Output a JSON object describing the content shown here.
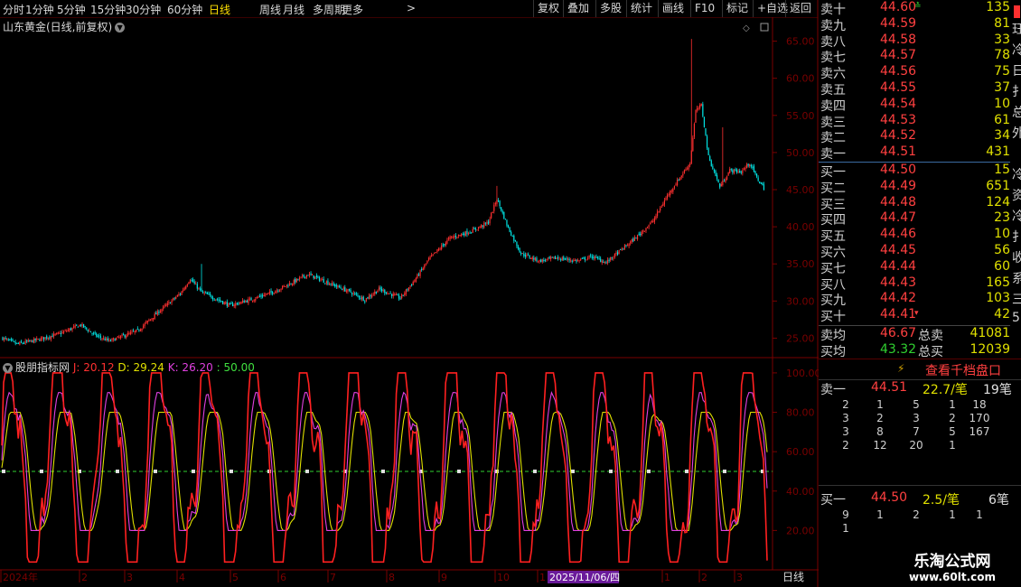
{
  "toolbar": {
    "periods": [
      "分时",
      "1分钟",
      "5分钟",
      "15分钟",
      "30分钟",
      "60分钟",
      "日线",
      "周线",
      "月线",
      "多周期",
      "更多"
    ],
    "active": "日线",
    "more_arrow": ">",
    "right_buttons": [
      "复权",
      "叠加",
      "多股",
      "统计",
      "画线",
      "F10",
      "标记",
      "+自选",
      "返回"
    ]
  },
  "chart": {
    "title": "山东黄金(日线,前复权)",
    "price_axis": [
      "65.00",
      "60.00",
      "55.00",
      "50.00",
      "45.00",
      "40.00",
      "35.00",
      "30.00",
      "25.00"
    ],
    "ylim": [
      22.5,
      67.5
    ],
    "up_color": "#ff3030",
    "down_color": "#00e5e5"
  },
  "indicator": {
    "name": "股朋指标网",
    "j_label": "J: 20.12",
    "d_label": "D: 29.24",
    "k_label": "K: 26.20",
    "level_label": ": 50.00",
    "axis": [
      "100.00",
      "80.00",
      "60.00",
      "40.00",
      "20.00"
    ],
    "ylim": [
      0,
      105
    ]
  },
  "time_axis": {
    "labels": [
      "2024年",
      "2",
      "3",
      "4",
      "5",
      "6",
      "7",
      "8",
      "9",
      "10",
      "1",
      "1",
      "2",
      "3"
    ],
    "cursor_date": "2025/11/06/四",
    "period_label": "日线"
  },
  "orderbook": {
    "asks": [
      {
        "label": "卖十",
        "price": "44.60",
        "vol": "135",
        "mark": "≛"
      },
      {
        "label": "卖九",
        "price": "44.59",
        "vol": "81"
      },
      {
        "label": "卖八",
        "price": "44.58",
        "vol": "33"
      },
      {
        "label": "卖七",
        "price": "44.57",
        "vol": "78"
      },
      {
        "label": "卖六",
        "price": "44.56",
        "vol": "75"
      },
      {
        "label": "卖五",
        "price": "44.55",
        "vol": "37"
      },
      {
        "label": "卖四",
        "price": "44.54",
        "vol": "10"
      },
      {
        "label": "卖三",
        "price": "44.53",
        "vol": "61"
      },
      {
        "label": "卖二",
        "price": "44.52",
        "vol": "34"
      },
      {
        "label": "卖一",
        "price": "44.51",
        "vol": "431"
      }
    ],
    "bids": [
      {
        "label": "买一",
        "price": "44.50",
        "vol": "15"
      },
      {
        "label": "买二",
        "price": "44.49",
        "vol": "651"
      },
      {
        "label": "买三",
        "price": "44.48",
        "vol": "124"
      },
      {
        "label": "买四",
        "price": "44.47",
        "vol": "23"
      },
      {
        "label": "买五",
        "price": "44.46",
        "vol": "10"
      },
      {
        "label": "买六",
        "price": "44.45",
        "vol": "56"
      },
      {
        "label": "买七",
        "price": "44.44",
        "vol": "60"
      },
      {
        "label": "买八",
        "price": "44.43",
        "vol": "165"
      },
      {
        "label": "买九",
        "price": "44.42",
        "vol": "103"
      },
      {
        "label": "买十",
        "price": "44.41",
        "vol": "42",
        "mark": "▾"
      }
    ],
    "avg_sell_label": "卖均",
    "avg_sell": "46.67",
    "total_sell_label": "总卖",
    "total_sell": "41081",
    "avg_buy_label": "买均",
    "avg_buy": "43.32",
    "total_buy_label": "总买",
    "total_buy": "12039"
  },
  "right_cut": [
    "珏",
    "冷",
    "日",
    "扌",
    "总",
    "外",
    "",
    "冷",
    "资",
    "冷",
    "扌",
    "收",
    "系",
    "三",
    "5"
  ],
  "detail": {
    "button": "查看千档盘口",
    "sell1_label": "卖一",
    "sell1_price": "44.51",
    "sell1_avg": "22.7/笔",
    "sell1_count": "19笔",
    "sell_queue": [
      [
        "2",
        "1",
        "5",
        "1",
        "18"
      ],
      [
        "3",
        "2",
        "3",
        "2",
        "170"
      ],
      [
        "3",
        "8",
        "7",
        "5",
        "167"
      ],
      [
        "2",
        "12",
        "20",
        "1",
        ""
      ]
    ],
    "buy1_label": "买一",
    "buy1_price": "44.50",
    "buy1_avg": "2.5/笔",
    "buy1_count": "6笔",
    "buy_queue": [
      [
        "9",
        "1",
        "2",
        "1",
        "1"
      ],
      [
        "1",
        "",
        "",
        "",
        ""
      ]
    ]
  },
  "watermark": {
    "line1": "乐淘公式网",
    "line2": "www.60lt.com"
  }
}
